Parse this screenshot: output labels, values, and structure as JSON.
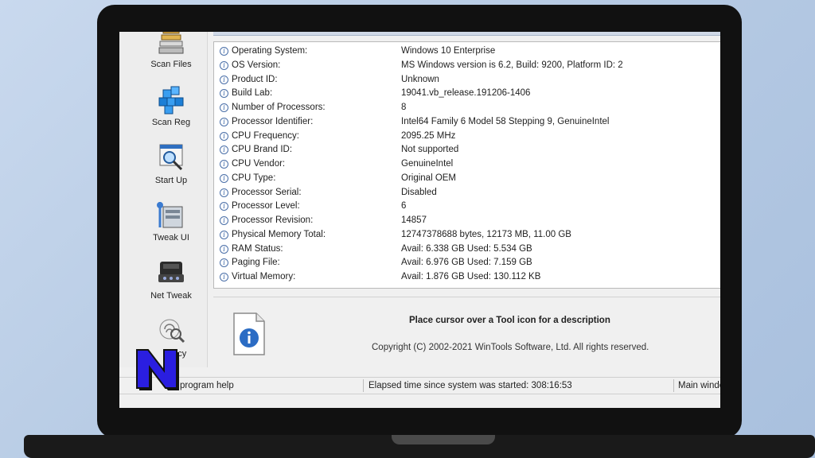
{
  "toolbar": {
    "items": [
      {
        "label": "Scan Files",
        "icon": "scan-files-icon"
      },
      {
        "label": "Scan Reg",
        "icon": "scan-reg-icon"
      },
      {
        "label": "Start Up",
        "icon": "start-up-icon"
      },
      {
        "label": "Tweak UI",
        "icon": "tweak-ui-icon"
      },
      {
        "label": "Net Tweak",
        "icon": "net-tweak-icon"
      },
      {
        "label": "vacy",
        "icon": "privacy-icon"
      }
    ]
  },
  "system_info": {
    "rows": [
      {
        "label": "Operating System:",
        "value": "Windows 10 Enterprise"
      },
      {
        "label": "OS Version:",
        "value": "MS Windows version is 6.2, Build: 9200, Platform ID: 2"
      },
      {
        "label": "Product ID:",
        "value": "Unknown"
      },
      {
        "label": "Build Lab:",
        "value": "19041.vb_release.191206-1406"
      },
      {
        "label": "Number of Processors:",
        "value": "8"
      },
      {
        "label": "Processor Identifier:",
        "value": "Intel64 Family 6 Model 58 Stepping 9, GenuineIntel"
      },
      {
        "label": "CPU Frequency:",
        "value": "2095.25 MHz"
      },
      {
        "label": "CPU Brand ID:",
        "value": "Not supported"
      },
      {
        "label": "CPU Vendor:",
        "value": "GenuineIntel"
      },
      {
        "label": "CPU Type:",
        "value": "Original OEM"
      },
      {
        "label": "Processor Serial:",
        "value": "Disabled"
      },
      {
        "label": "Processor Level:",
        "value": "6"
      },
      {
        "label": "Processor Revision:",
        "value": "14857"
      },
      {
        "label": "Physical Memory Total:",
        "value": "12747378688 bytes, 12173 MB, 11.00 GB"
      },
      {
        "label": "RAM Status:",
        "value": "Avail: 6.338 GB  Used: 5.534 GB"
      },
      {
        "label": "Paging File:",
        "value": "Avail: 6.976 GB  Used: 7.159 GB"
      },
      {
        "label": "Virtual Memory:",
        "value": "Avail: 1.876 GB  Used: 130.112 KB"
      }
    ]
  },
  "description": {
    "title": "Place cursor over a Tool icon for a description",
    "copyright": "Copyright (C) 2002-2021 WinTools Software, Ltd. All rights reserved."
  },
  "status_bar": {
    "help": "program help",
    "elapsed": "Elapsed time since system was started: 308:16:53",
    "main": "Main window"
  },
  "colors": {
    "accent_blue": "#2b6cc4",
    "logo_fill": "#2a1ee0"
  }
}
